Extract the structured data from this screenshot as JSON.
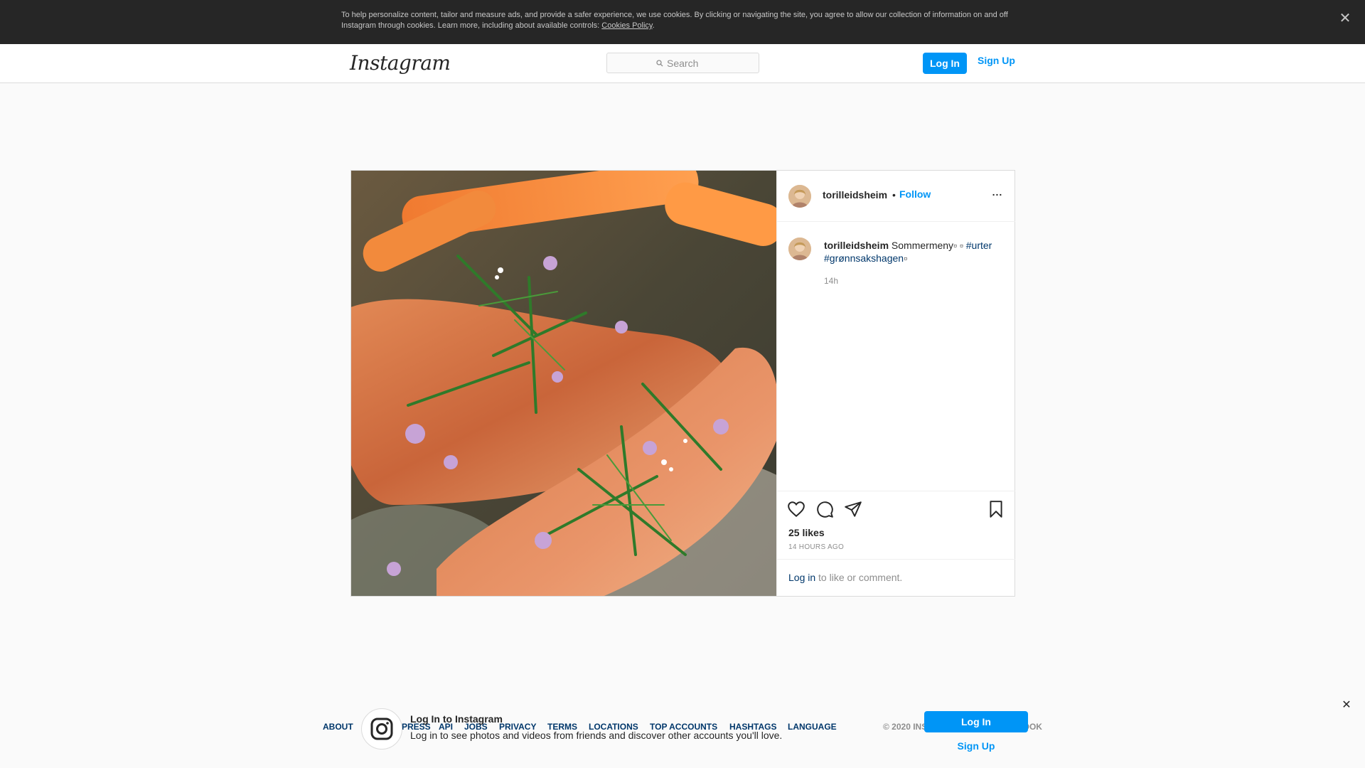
{
  "cookie_banner": {
    "text": "To help personalize content, tailor and measure ads, and provide a safer experience, we use cookies. By clicking or navigating the site, you agree to allow our collection of information on and off Instagram through cookies. Learn more, including about available controls: ",
    "policy_link": "Cookies Policy",
    "policy_suffix": ".",
    "close_glyph": "✕"
  },
  "nav": {
    "logo": "Instagram",
    "search_placeholder": "Search",
    "login_label": "Log In",
    "signup_label": "Sign Up"
  },
  "post": {
    "username": "torilleidsheim",
    "follow_separator": "•",
    "follow_label": "Follow",
    "more_glyph": "...",
    "caption": {
      "username": "torilleidsheim",
      "text": " Sommermeny▫ ▫ ",
      "hashtag1": "#urter",
      "hashtag2": "#grønnsakshagen",
      "hashtag2_suffix": "▫",
      "time": "14h"
    },
    "likes": "25 likes",
    "age": "14 HOURS AGO",
    "login_link": "Log in",
    "login_suffix": " to like or comment.",
    "icons": {
      "like": "heart-icon",
      "comment": "comment-icon",
      "share": "share-icon",
      "save": "bookmark-icon"
    }
  },
  "footer": {
    "links": [
      "About",
      "Press",
      "API",
      "Jobs",
      "Privacy",
      "Terms",
      "Locations",
      "Top Accounts",
      "Hashtags",
      "Language"
    ],
    "copyright": "© 2020 Instagram from Facebook"
  },
  "login_overlay": {
    "title": "Log In to Instagram",
    "subtitle": "Log in to see photos and videos from friends and discover other accounts you'll love.",
    "login_label": "Log In",
    "signup_label": "Sign Up",
    "close_glyph": "✕"
  },
  "colors": {
    "accent": "#0095f6",
    "link_dark": "#00376b",
    "banner_bg": "#262626"
  }
}
